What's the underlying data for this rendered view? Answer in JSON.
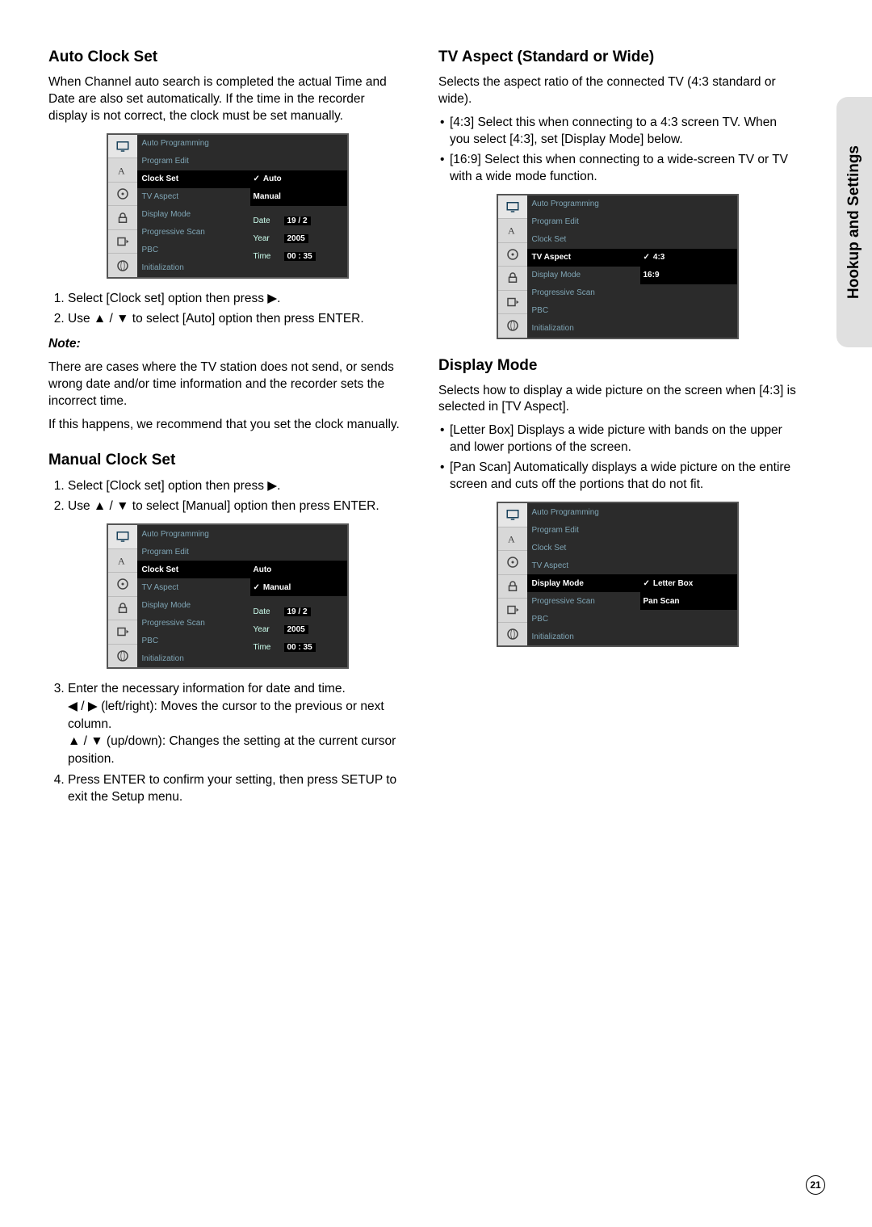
{
  "sidebar_label": "Hookup and Settings",
  "page_number": "21",
  "left": {
    "h_auto": "Auto Clock Set",
    "p_auto": "When Channel auto search is completed the actual Time and Date are also set automatically. If the time in the recorder display is not correct, the clock must be set manually.",
    "osd1_menu": [
      "Auto Programming",
      "Program Edit",
      "Clock Set",
      "TV Aspect",
      "Display Mode",
      "Progressive Scan",
      "PBC",
      "Initialization"
    ],
    "osd1_sel": "Clock Set",
    "osd1_opts": [
      "Auto",
      "Manual"
    ],
    "osd1_checked": "Auto",
    "osd1_date_label": "Date",
    "osd1_date_val": "19 /   2",
    "osd1_year_label": "Year",
    "osd1_year_val": "2005",
    "osd1_time_label": "Time",
    "osd1_time_val": "00 :  35",
    "steps_auto": [
      "Select [Clock set] option then press ▶.",
      "Use ▲ / ▼ to select [Auto] option then press ENTER."
    ],
    "note_label": "Note:",
    "note_p1": "There are cases where the TV station does not send, or sends wrong date and/or time information and the recorder sets the incorrect time.",
    "note_p2": "If this happens, we recommend that you set the clock manually.",
    "h_manual": "Manual Clock Set",
    "steps_manual_12": [
      "Select [Clock set] option then press ▶.",
      "Use ▲ / ▼ to select [Manual] option then press ENTER."
    ],
    "osd2_checked": "Manual",
    "step3_a": "Enter the necessary information for date and time.",
    "step3_b": "◀ / ▶ (left/right): Moves the cursor to the previous or next column.",
    "step3_c": "▲ / ▼ (up/down): Changes the setting at the current cursor position.",
    "step4": "Press ENTER to confirm your setting, then press SETUP to exit the Setup menu."
  },
  "right": {
    "h_tv": "TV Aspect (Standard or Wide)",
    "p_tv": "Selects the aspect ratio of the connected TV (4:3 standard or wide).",
    "tv_bullets": [
      "[4:3] Select this when connecting to a 4:3 screen TV. When you select [4:3], set [Display Mode] below.",
      "[16:9] Select this when connecting to a wide-screen TV or TV with a wide mode function."
    ],
    "osd3_sel": "TV Aspect",
    "osd3_opts": [
      "4:3",
      "16:9"
    ],
    "osd3_checked": "4:3",
    "h_disp": "Display Mode",
    "p_disp": "Selects how to display a wide picture on the screen when [4:3] is selected in [TV Aspect].",
    "disp_bullets": [
      "[Letter Box] Displays a wide picture with bands on the upper and lower portions of the screen.",
      "[Pan Scan] Automatically displays a wide picture on the entire screen and cuts off the portions that do not fit."
    ],
    "osd4_sel": "Display Mode",
    "osd4_opts": [
      "Letter Box",
      "Pan Scan"
    ],
    "osd4_checked": "Letter Box"
  },
  "icon_alt": {
    "tv": "tv",
    "text": "text",
    "disc": "disc",
    "lock": "lock",
    "rec": "rec",
    "net": "network"
  }
}
